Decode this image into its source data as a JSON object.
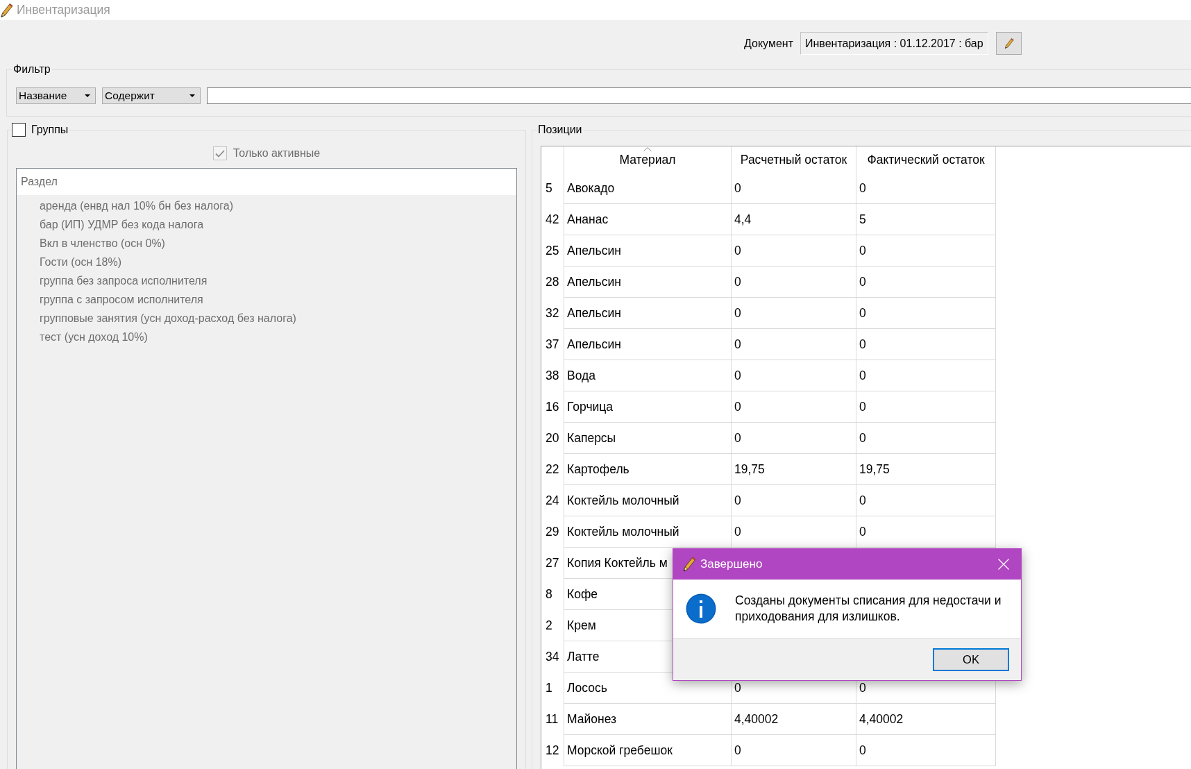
{
  "window": {
    "title": "Инвентаризация"
  },
  "document": {
    "label": "Документ",
    "value": "Инвентаризация : 01.12.2017 : бар"
  },
  "filter": {
    "title": "Фильтр",
    "field": "Название",
    "condition": "Содержит"
  },
  "groups": {
    "label": "Группы",
    "checked": false,
    "active_only": {
      "label": "Только активные",
      "checked": true,
      "disabled": true
    },
    "tree": {
      "header": "Раздел",
      "disabled": true,
      "items": [
        "аренда (енвд нал 10% бн без налога)",
        "бар (ИП) УДМР без кода налога",
        "Вкл в членство (осн 0%)",
        "Гости (осн 18%)",
        "группа без запроса исполнителя",
        "группа с запросом исполнителя",
        "групповые занятия (усн доход-расход без налога)",
        "тест (усн доход 10%)"
      ]
    }
  },
  "positions": {
    "title": "Позиции",
    "columns": [
      {
        "label": "Материал",
        "sorted": true
      },
      {
        "label": "Расчетный остаток",
        "sorted": false
      },
      {
        "label": "Фактический остаток",
        "sorted": false
      }
    ],
    "rows": [
      {
        "number": "5",
        "material": "Авокадо",
        "calculated": "0",
        "actual": "0"
      },
      {
        "number": "42",
        "material": "Ананас",
        "calculated": "4,4",
        "actual": "5"
      },
      {
        "number": "25",
        "material": "Апельсин",
        "calculated": "0",
        "actual": "0"
      },
      {
        "number": "28",
        "material": "Апельсин",
        "calculated": "0",
        "actual": "0"
      },
      {
        "number": "32",
        "material": "Апельсин",
        "calculated": "0",
        "actual": "0"
      },
      {
        "number": "37",
        "material": "Апельсин",
        "calculated": "0",
        "actual": "0"
      },
      {
        "number": "38",
        "material": "Вода",
        "calculated": "0",
        "actual": "0"
      },
      {
        "number": "16",
        "material": "Горчица",
        "calculated": "0",
        "actual": "0"
      },
      {
        "number": "20",
        "material": "Каперсы",
        "calculated": "0",
        "actual": "0"
      },
      {
        "number": "22",
        "material": "Картофель",
        "calculated": "19,75",
        "actual": "19,75"
      },
      {
        "number": "24",
        "material": "Коктейль молочный",
        "calculated": "0",
        "actual": "0"
      },
      {
        "number": "29",
        "material": "Коктейль молочный",
        "calculated": "0",
        "actual": "0"
      },
      {
        "number": "27",
        "material": "Копия Коктейль м"
      },
      {
        "number": "8",
        "material": "Кофе"
      },
      {
        "number": "2",
        "material": "Крем"
      },
      {
        "number": "34",
        "material": "Латте"
      },
      {
        "number": "1",
        "material": "Лосось",
        "calculated": "0",
        "actual": "0"
      },
      {
        "number": "11",
        "material": "Майонез",
        "calculated": "4,40002",
        "actual": "4,40002"
      },
      {
        "number": "12",
        "material": "Морской гребешок",
        "calculated": "0",
        "actual": "0"
      }
    ]
  },
  "dialog": {
    "title": "Завершено",
    "message": "Созданы документы списания для недостачи и приходования для излишков.",
    "buttons": [
      "OK"
    ]
  }
}
